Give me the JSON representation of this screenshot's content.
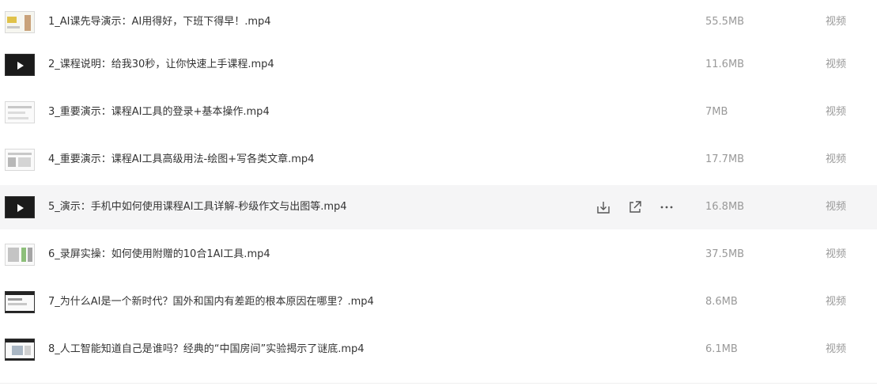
{
  "files": [
    {
      "name": "1_AI课先导演示：AI用得好，下班下得早！.mp4",
      "size": "55.5MB",
      "type": "视频",
      "thumb": "light-person"
    },
    {
      "name": "2_课程说明：给我30秒，让你快速上手课程.mp4",
      "size": "11.6MB",
      "type": "视频",
      "thumb": "dark-play"
    },
    {
      "name": "3_重要演示：课程AI工具的登录+基本操作.mp4",
      "size": "7MB",
      "type": "视频",
      "thumb": "light-doc"
    },
    {
      "name": "4_重要演示：课程AI工具高级用法-绘图+写各类文章.mp4",
      "size": "17.7MB",
      "type": "视频",
      "thumb": "light-doc"
    },
    {
      "name": "5_演示：手机中如何使用课程AI工具详解-秒级作文与出图等.mp4",
      "size": "16.8MB",
      "type": "视频",
      "thumb": "dark-play"
    },
    {
      "name": "6_录屏实操：如何使用附赠的10合1AI工具.mp4",
      "size": "37.5MB",
      "type": "视频",
      "thumb": "light-doc"
    },
    {
      "name": "7_为什么AI是一个新时代？国外和国内有差距的根本原因在哪里？.mp4",
      "size": "8.6MB",
      "type": "视频",
      "thumb": "light-slide"
    },
    {
      "name": "8_人工智能知道自己是谁吗？经典的“中国房间”实验揭示了谜底.mp4",
      "size": "6.1MB",
      "type": "视频",
      "thumb": "light-slide"
    }
  ],
  "hovered_row": 4,
  "row_actions": [
    {
      "icon": "download-icon"
    },
    {
      "icon": "share-icon"
    },
    {
      "icon": "more-icon"
    }
  ],
  "colors": {
    "text": "#333333",
    "muted": "#999999",
    "hover_bg": "#f5f5f6",
    "icon": "#555555"
  }
}
